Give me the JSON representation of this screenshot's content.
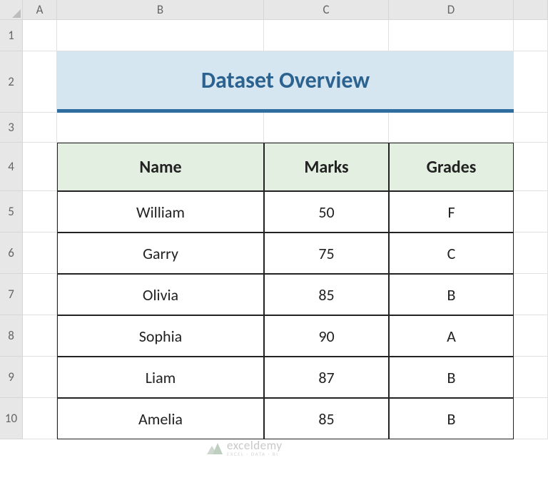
{
  "columns": [
    "",
    "A",
    "B",
    "C",
    "D",
    ""
  ],
  "rows": [
    "1",
    "2",
    "3",
    "4",
    "5",
    "6",
    "7",
    "8",
    "9",
    "10"
  ],
  "title": "Dataset Overview",
  "headers": {
    "name": "Name",
    "marks": "Marks",
    "grades": "Grades"
  },
  "data": [
    {
      "name": "William",
      "marks": "50",
      "grades": "F"
    },
    {
      "name": "Garry",
      "marks": "75",
      "grades": "C"
    },
    {
      "name": "Olivia",
      "marks": "85",
      "grades": "B"
    },
    {
      "name": "Sophia",
      "marks": "90",
      "grades": "A"
    },
    {
      "name": "Liam",
      "marks": "87",
      "grades": "B"
    },
    {
      "name": "Amelia",
      "marks": "85",
      "grades": "B"
    }
  ],
  "watermark": {
    "main": "exceldemy",
    "sub": "EXCEL · DATA · BI"
  }
}
